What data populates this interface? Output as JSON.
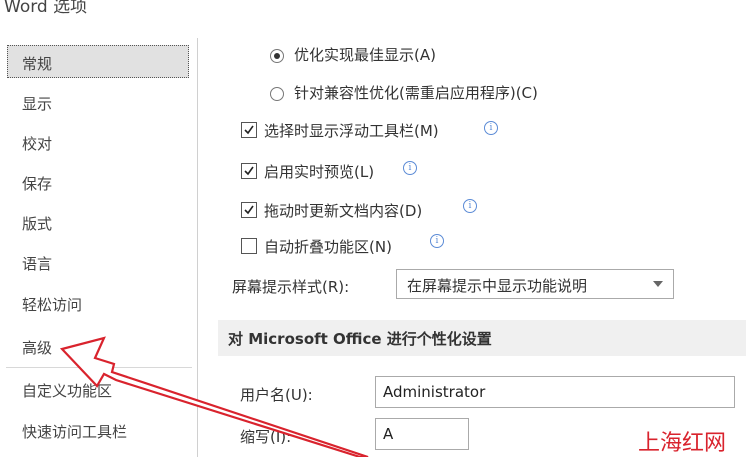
{
  "window": {
    "title": "Word 选项"
  },
  "sidebar": {
    "items": [
      {
        "label": "常规"
      },
      {
        "label": "显示"
      },
      {
        "label": "校对"
      },
      {
        "label": "保存"
      },
      {
        "label": "版式"
      },
      {
        "label": "语言"
      },
      {
        "label": "轻松访问"
      },
      {
        "label": "高级"
      },
      {
        "label": "自定义功能区"
      },
      {
        "label": "快速访问工具栏"
      }
    ],
    "selected": "常规"
  },
  "general": {
    "radio_optimize_display": "优化实现最佳显示(A)",
    "radio_compat": "针对兼容性优化(需重启应用程序)(C)",
    "cb_mini_toolbar": "选择时显示浮动工具栏(M)",
    "cb_live_preview": "启用实时预览(L)",
    "cb_update_drag": "拖动时更新文档内容(D)",
    "cb_collapse_ribbon": "自动折叠功能区(N)",
    "screentip_label": "屏幕提示样式(R):",
    "screentip_value": "在屏幕提示中显示功能说明",
    "personalize_header": "对 Microsoft Office 进行个性化设置",
    "username_label": "用户名(U):",
    "username_value": "Administrator",
    "initials_label": "缩写(I):",
    "initials_value": "A"
  },
  "watermark": "上海红网"
}
